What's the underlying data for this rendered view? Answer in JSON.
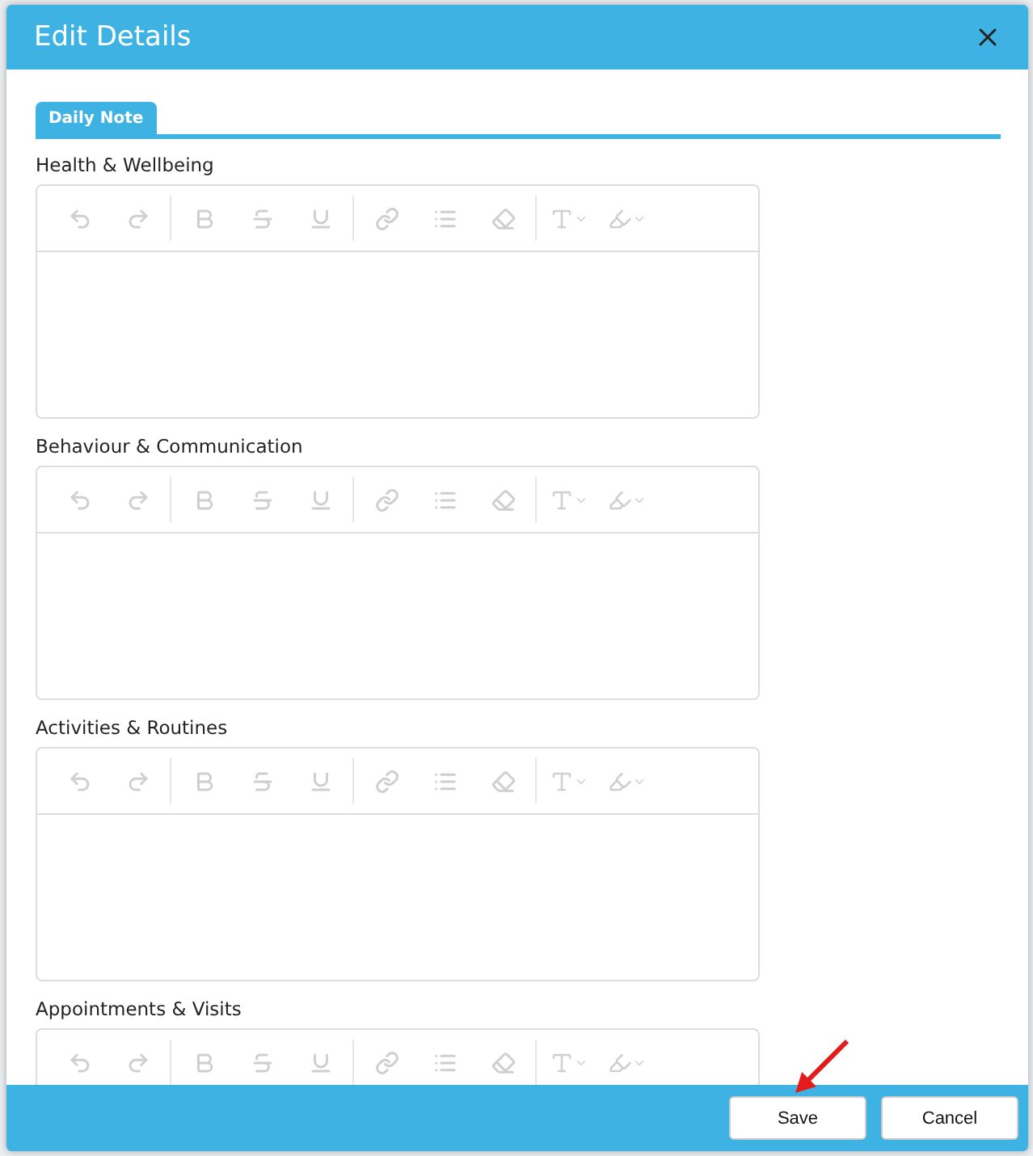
{
  "dialog": {
    "title": "Edit Details"
  },
  "tabs": [
    {
      "label": "Daily Note",
      "selected": true
    }
  ],
  "editors": [
    {
      "label": "Health & Wellbeing",
      "toolbar_disabled": true
    },
    {
      "label": "Behaviour & Communication",
      "toolbar_disabled": true
    },
    {
      "label": "Activities & Routines",
      "toolbar_disabled": true
    },
    {
      "label": "Appointments & Visits",
      "toolbar_disabled": true
    }
  ],
  "buttons": [
    {
      "label": "Save",
      "annotated": true
    },
    {
      "label": "Cancel",
      "annotated": false
    }
  ]
}
